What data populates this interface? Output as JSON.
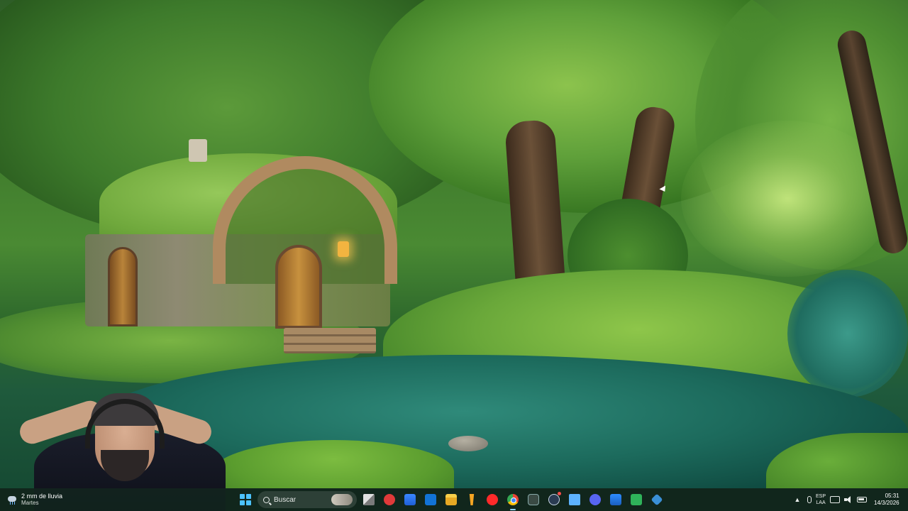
{
  "desktop": {
    "wallpaper": "hobbit-house-forest-river"
  },
  "taskbar": {
    "weather": {
      "temperature_line": "2 mm de lluvia",
      "day": "Martes",
      "icon": "rain-cloud-icon"
    },
    "search": {
      "placeholder": "Buscar"
    },
    "apps": [
      {
        "name": "task-view",
        "icon": "task-view-icon"
      },
      {
        "name": "red-app",
        "icon": "red-circle-icon"
      },
      {
        "name": "microsoft-store",
        "icon": "store-icon"
      },
      {
        "name": "outlook",
        "icon": "outlook-icon"
      },
      {
        "name": "file-explorer",
        "icon": "folder-icon"
      },
      {
        "name": "obs",
        "icon": "lamp-icon"
      },
      {
        "name": "youtube",
        "icon": "play-icon"
      },
      {
        "name": "chrome",
        "icon": "chrome-icon"
      },
      {
        "name": "gamepad",
        "icon": "gamepad-icon"
      },
      {
        "name": "steam",
        "icon": "steam-icon"
      },
      {
        "name": "notepad",
        "icon": "notepad-icon"
      },
      {
        "name": "discord",
        "icon": "discord-icon"
      },
      {
        "name": "photos",
        "icon": "photos-icon"
      },
      {
        "name": "green-app",
        "icon": "green-app-icon"
      },
      {
        "name": "blue-app",
        "icon": "diamond-icon"
      }
    ],
    "tray": {
      "language_top": "ESP",
      "language_bottom": "LAA",
      "time": "05:31",
      "date": "14/3/2026"
    }
  },
  "colors": {
    "accent": "#4cc2ff",
    "taskbar_bg": "#12261e"
  }
}
